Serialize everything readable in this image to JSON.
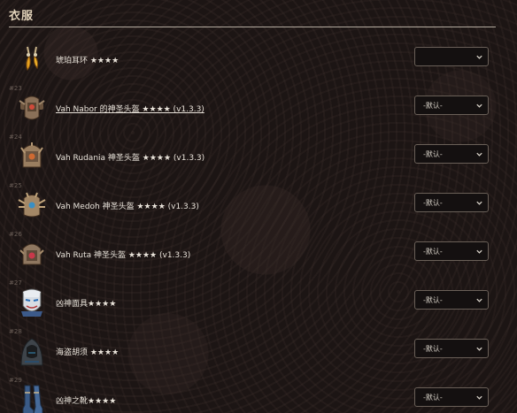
{
  "header": {
    "title": "衣服"
  },
  "items": [
    {
      "index": "",
      "name": "琥珀耳环 ★★★★",
      "link": false,
      "icon": "amber-earrings-icon",
      "selected": ""
    },
    {
      "index": "#23",
      "name": "Vah Nabor 的神圣头盔 ★★★★ (v1.3.3)",
      "link": true,
      "icon": "divine-helm-naboris-icon",
      "selected": "-默认-"
    },
    {
      "index": "#24",
      "name": "Vah Rudania 神圣头盔 ★★★★ (v1.3.3)",
      "link": false,
      "icon": "divine-helm-rudania-icon",
      "selected": "-默认-"
    },
    {
      "index": "#25",
      "name": "Vah Medoh 神圣头盔 ★★★★ (v1.3.3)",
      "link": false,
      "icon": "divine-helm-medoh-icon",
      "selected": "-默认-"
    },
    {
      "index": "#26",
      "name": "Vah Ruta 神圣头盔 ★★★★ (v1.3.3)",
      "link": false,
      "icon": "divine-helm-ruta-icon",
      "selected": "-默认-"
    },
    {
      "index": "#27",
      "name": "凶神面具★★★★",
      "link": false,
      "icon": "fierce-deity-mask-icon",
      "selected": "-默认-"
    },
    {
      "index": "#28",
      "name": "海盗胡须 ★★★★",
      "link": false,
      "icon": "hooded-figure-icon",
      "selected": "-默认-"
    },
    {
      "index": "#29",
      "name": "凶神之靴★★★★",
      "link": false,
      "icon": "fierce-deity-boots-icon",
      "selected": "-默认-"
    }
  ]
}
